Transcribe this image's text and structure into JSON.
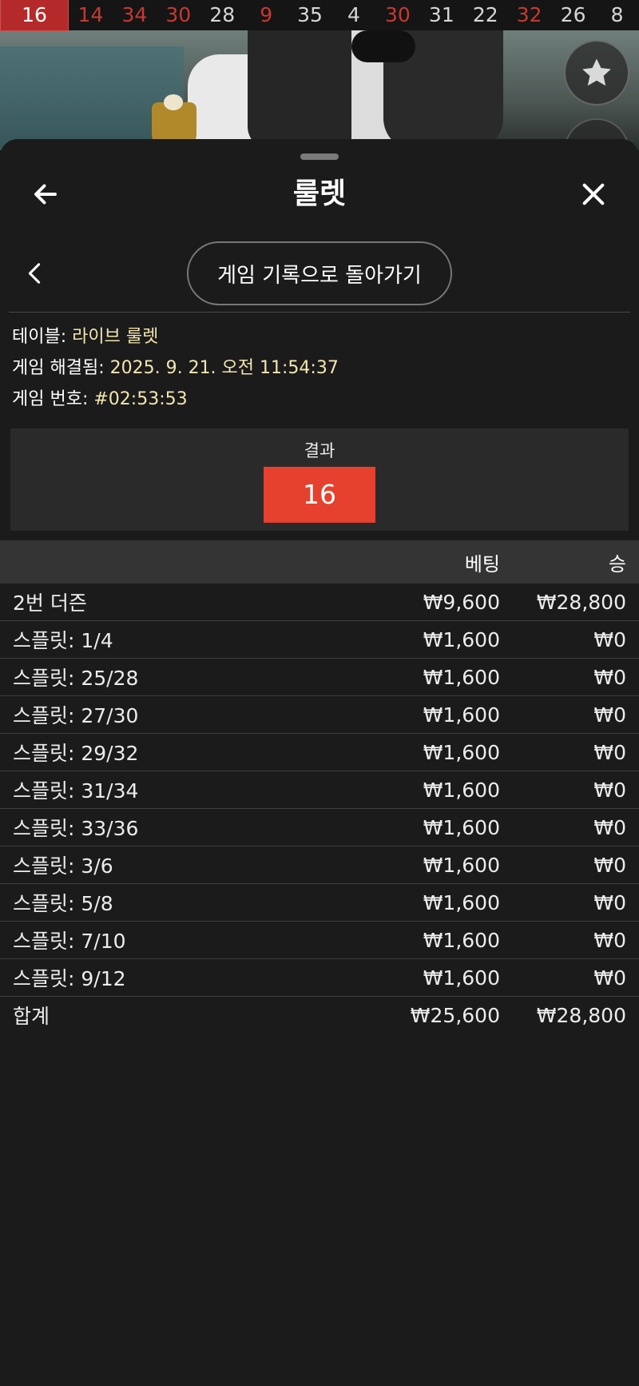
{
  "results_strip": {
    "current": "16",
    "numbers": [
      {
        "value": "14",
        "color": "red"
      },
      {
        "value": "34",
        "color": "red"
      },
      {
        "value": "30",
        "color": "red"
      },
      {
        "value": "28",
        "color": "gray"
      },
      {
        "value": "9",
        "color": "red"
      },
      {
        "value": "35",
        "color": "gray"
      },
      {
        "value": "4",
        "color": "gray"
      },
      {
        "value": "30",
        "color": "red"
      },
      {
        "value": "31",
        "color": "gray"
      },
      {
        "value": "22",
        "color": "gray"
      },
      {
        "value": "32",
        "color": "red"
      },
      {
        "value": "26",
        "color": "gray"
      },
      {
        "value": "8",
        "color": "gray"
      }
    ]
  },
  "header": {
    "title": "룰렛",
    "back_icon": "arrow-left-icon",
    "close_icon": "close-icon"
  },
  "navigation": {
    "back_to_history_label": "게임 기록으로 돌아가기",
    "prev_icon": "chevron-left-icon"
  },
  "game_info": {
    "table_label": "테이블: ",
    "table_value": "라이브 룰렛",
    "resolved_label": "게임 해결됨: ",
    "resolved_value": "2025. 9. 21. 오전 11:54:37",
    "game_no_label": "게임 번호: ",
    "game_no_value": "#02:53:53"
  },
  "result": {
    "label": "결과",
    "number": "16",
    "color": "#e5412e"
  },
  "bets_table": {
    "headers": {
      "name": "",
      "bet": "베팅",
      "win": "승"
    },
    "rows": [
      {
        "name": "2번 더즌",
        "bet": "₩9,600",
        "win": "₩28,800"
      },
      {
        "name": "스플릿: 1/4",
        "bet": "₩1,600",
        "win": "₩0"
      },
      {
        "name": "스플릿: 25/28",
        "bet": "₩1,600",
        "win": "₩0"
      },
      {
        "name": "스플릿: 27/30",
        "bet": "₩1,600",
        "win": "₩0"
      },
      {
        "name": "스플릿: 29/32",
        "bet": "₩1,600",
        "win": "₩0"
      },
      {
        "name": "스플릿: 31/34",
        "bet": "₩1,600",
        "win": "₩0"
      },
      {
        "name": "스플릿: 33/36",
        "bet": "₩1,600",
        "win": "₩0"
      },
      {
        "name": "스플릿: 3/6",
        "bet": "₩1,600",
        "win": "₩0"
      },
      {
        "name": "스플릿: 5/8",
        "bet": "₩1,600",
        "win": "₩0"
      },
      {
        "name": "스플릿: 7/10",
        "bet": "₩1,600",
        "win": "₩0"
      },
      {
        "name": "스플릿: 9/12",
        "bet": "₩1,600",
        "win": "₩0"
      }
    ],
    "total": {
      "name": "합계",
      "bet": "₩25,600",
      "win": "₩28,800"
    }
  },
  "colors": {
    "red_number": "#c43a32",
    "result_red": "#e5412e",
    "info_value": "#f3e6b0",
    "sheet_bg": "#1b1b1b"
  }
}
